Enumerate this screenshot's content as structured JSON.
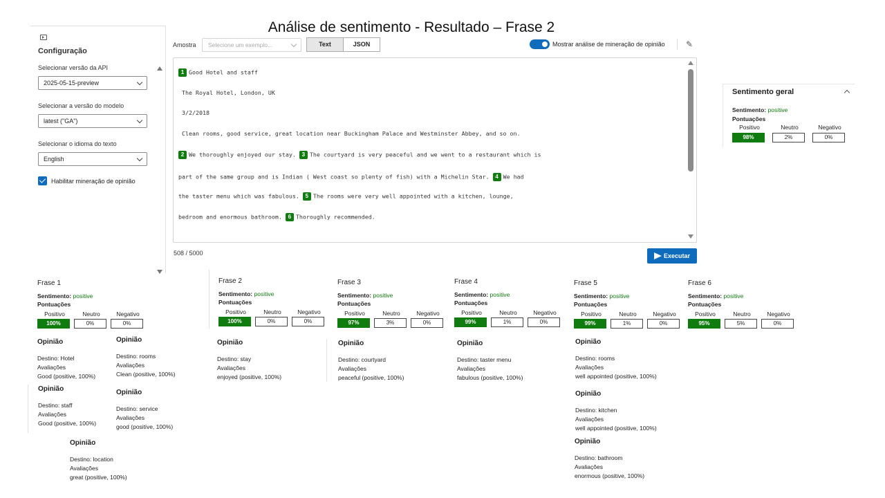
{
  "page_title": "Análise de sentimento - Resultado – Frase 2",
  "config": {
    "title": "Configuração",
    "api_label": "Selecionar versão da API",
    "api_value": "2025-05-15-preview",
    "model_label": "Selecionar a versão do modelo",
    "model_value": "latest (\"GA\")",
    "lang_label": "Selecionar o idioma do texto",
    "lang_value": "English",
    "opinion_mining_label": "Habilitar mineração de opinião",
    "opinion_mining_checked": true
  },
  "toolbar": {
    "sample_label": "Amostra",
    "sample_placeholder": "Selecione um exemplo...",
    "text_button": "Text",
    "json_button": "JSON",
    "toggle_label": "Mostrar análise de mineração de opinião",
    "toggle_on": true
  },
  "editor": {
    "line1": "Good Hotel and staff",
    "line2": "The Royal Hotel, London, UK",
    "line3": "3/2/2018",
    "line4": "Clean rooms, good service, great location near Buckingham Palace and Westminster Abbey, and so on.",
    "s2": "We thoroughly enjoyed our stay.",
    "s3a": "The courtyard is very peaceful and we went to a restaurant which is",
    "s3b": "part of the same group and is Indian ( West coast so plenty of fish) with a Michelin Star.",
    "s4a": "We had",
    "s4b": "the taster menu which was fabulous.",
    "s5": "The rooms were very well appointed with a kitchen, lounge,",
    "s5b": "bedroom and enormous bathroom.",
    "s6": "Thoroughly recommended.",
    "badges": [
      "1",
      "2",
      "3",
      "4",
      "5",
      "6"
    ]
  },
  "char_count": "508 / 5000",
  "run_button": "Executar",
  "overall": {
    "title": "Sentimento geral",
    "sentiment_label": "Sentimento:",
    "sentiment_value": "positive",
    "scores_label": "Pontuações",
    "headers": [
      "Positivo",
      "Neutro",
      "Negativo"
    ],
    "values": [
      "98%",
      "2%",
      "0%"
    ]
  },
  "labels": {
    "sentiment": "Sentimento:",
    "scores": "Pontuações",
    "opinion": "Opinião",
    "target_prefix": "Destino: ",
    "assessments": "Avaliações",
    "headers": [
      "Positivo",
      "Neutro",
      "Negativo"
    ]
  },
  "sentences": [
    {
      "title": "Frase 1",
      "sentiment": "positive",
      "scores": [
        "100%",
        "0%",
        "0%"
      ],
      "opinions": [
        {
          "target": "Hotel",
          "assessment": "Good (positive, 100%)"
        },
        {
          "target": "rooms",
          "assessment": "Clean (positive, 100%)"
        },
        {
          "target": "staff",
          "assessment": "Good (positive, 100%)"
        },
        {
          "target": "service",
          "assessment": "good (positive, 100%)"
        },
        {
          "target": "location",
          "assessment": "great (positive, 100%)"
        }
      ]
    },
    {
      "title": "Frase 2",
      "sentiment": "positive",
      "scores": [
        "100%",
        "0%",
        "0%"
      ],
      "opinions": [
        {
          "target": "stay",
          "assessment": "enjoyed (positive, 100%)"
        }
      ]
    },
    {
      "title": "Frase 3",
      "sentiment": "positive",
      "scores": [
        "97%",
        "3%",
        "0%"
      ],
      "opinions": [
        {
          "target": "courtyard",
          "assessment": "peaceful (positive, 100%)"
        }
      ]
    },
    {
      "title": "Frase 4",
      "sentiment": "positive",
      "scores": [
        "99%",
        "1%",
        "0%"
      ],
      "opinions": [
        {
          "target": "taster menu",
          "assessment": "fabulous (positive, 100%)"
        }
      ]
    },
    {
      "title": "Frase 5",
      "sentiment": "positive",
      "scores": [
        "99%",
        "1%",
        "0%"
      ],
      "opinions": [
        {
          "target": "rooms",
          "assessment": "well appointed (positive, 100%)"
        },
        {
          "target": "kitchen",
          "assessment": "well appointed (positive, 100%)"
        },
        {
          "target": "bathroom",
          "assessment": "enormous (positive, 100%)"
        }
      ]
    },
    {
      "title": "Frase 6",
      "sentiment": "positive",
      "scores": [
        "95%",
        "5%",
        "0%"
      ],
      "opinions": []
    }
  ],
  "colors": {
    "accent": "#0f6cbd",
    "positive": "#107c10"
  }
}
